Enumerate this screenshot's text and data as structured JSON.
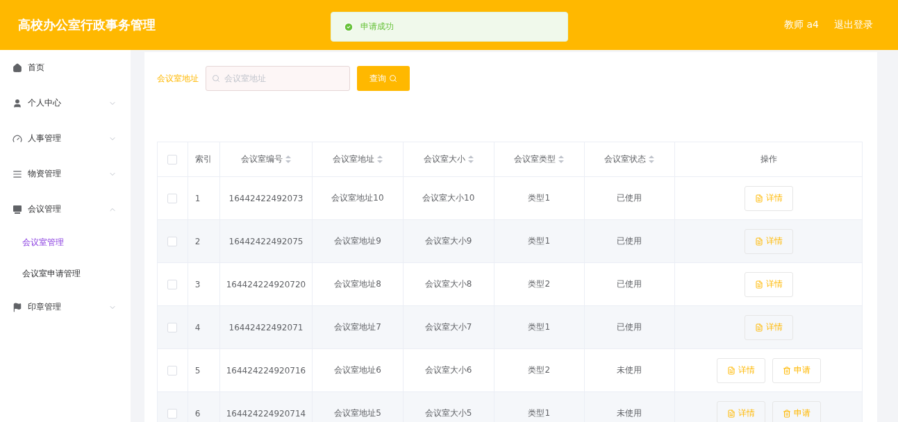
{
  "header": {
    "title": "高校办公室行政事务管理",
    "user": "教师 a4",
    "logout": "退出登录"
  },
  "toast": {
    "message": "申请成功"
  },
  "sidebar": {
    "items": [
      {
        "label": "首页"
      },
      {
        "label": "个人中心",
        "expanded": false
      },
      {
        "label": "人事管理",
        "expanded": false
      },
      {
        "label": "物资管理",
        "expanded": false
      },
      {
        "label": "会议管理",
        "expanded": true,
        "children": [
          {
            "label": "会议室管理",
            "selected": true
          },
          {
            "label": "会议室申请管理",
            "selected": false
          }
        ]
      },
      {
        "label": "印章管理",
        "expanded": false
      }
    ]
  },
  "search": {
    "label": "会议室地址",
    "placeholder": "会议室地址",
    "button": "查询"
  },
  "table": {
    "all_checked": false,
    "columns": [
      "索引",
      "会议室编号",
      "会议室地址",
      "会议室大小",
      "会议室类型",
      "会议室状态",
      "操作"
    ],
    "rows": [
      {
        "checked": false,
        "cells": [
          "1",
          "16442422492073",
          "会议室地址10",
          "会议室大小10",
          "类型1",
          "已使用"
        ],
        "actions": [
          {
            "kind": "detail",
            "label": "详情"
          }
        ]
      },
      {
        "checked": false,
        "cells": [
          "2",
          "16442422492075",
          "会议室地址9",
          "会议室大小9",
          "类型1",
          "已使用"
        ],
        "actions": [
          {
            "kind": "detail",
            "label": "详情"
          }
        ]
      },
      {
        "checked": false,
        "cells": [
          "3",
          "164424224920720",
          "会议室地址8",
          "会议室大小8",
          "类型2",
          "已使用"
        ],
        "actions": [
          {
            "kind": "detail",
            "label": "详情"
          }
        ]
      },
      {
        "checked": false,
        "cells": [
          "4",
          "16442422492071",
          "会议室地址7",
          "会议室大小7",
          "类型1",
          "已使用"
        ],
        "actions": [
          {
            "kind": "detail",
            "label": "详情"
          }
        ]
      },
      {
        "checked": false,
        "cells": [
          "5",
          "164424224920716",
          "会议室地址6",
          "会议室大小6",
          "类型2",
          "未使用"
        ],
        "actions": [
          {
            "kind": "detail",
            "label": "详情"
          },
          {
            "kind": "apply",
            "label": "申请"
          }
        ]
      },
      {
        "checked": false,
        "cells": [
          "6",
          "164424224920714",
          "会议室地址5",
          "会议室大小5",
          "类型1",
          "未使用"
        ],
        "actions": [
          {
            "kind": "detail",
            "label": "详情"
          },
          {
            "kind": "apply",
            "label": "申请"
          }
        ]
      }
    ]
  }
}
